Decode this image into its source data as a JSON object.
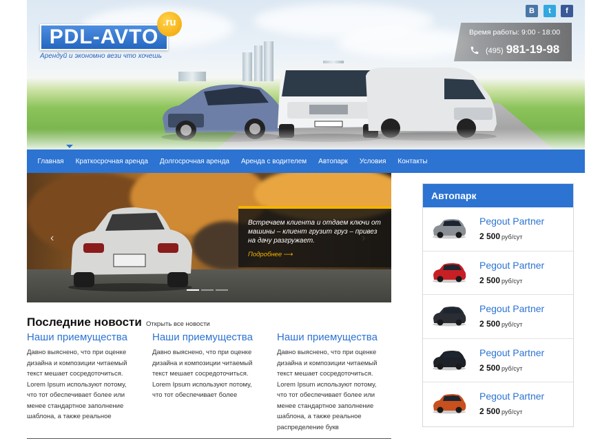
{
  "header": {
    "logo_text": "PDL-AVTO",
    "logo_suffix": ".ru",
    "slogan": "Арендуй и экономно вези что хочешь",
    "work_hours": "Время работы: 9:00 - 18:00",
    "phone_code": "(495)",
    "phone_number": "981-19-98",
    "social": [
      {
        "name": "vk",
        "label": "B",
        "color": "#4a76a8"
      },
      {
        "name": "twitter",
        "label": "t",
        "color": "#32a7e0"
      },
      {
        "name": "facebook",
        "label": "f",
        "color": "#3b5998"
      }
    ]
  },
  "nav": {
    "items": [
      "Главная",
      "Краткосрочная аренда",
      "Долгосрочная аренда",
      "Аренда с водителем",
      "Автопарк",
      "Условия",
      "Контакты"
    ]
  },
  "slider": {
    "text": "Встречаем клиента и отдаем ключи от машины – клиент грузит груз – привез на дачу разгружает.",
    "more": "Подробнее",
    "more_arrow": "⟶",
    "prev_arrow": "‹",
    "next_arrow": "›",
    "active_slide": 1,
    "slide_count": 3
  },
  "news": {
    "title": "Последние новости",
    "all_link": "Открыть все новости",
    "items": [
      {
        "title": "Наши приемущества",
        "text": "Давно выяснено, что при оценке дизайна и композиции читаемый текст мешает сосредоточиться. Lorem Ipsum используют потому, что тот обеспечивает более или менее стандартное заполнение шаблона, а также реальное"
      },
      {
        "title": "Наши приемущества",
        "text": "Давно выяснено, что при оценке дизайна и композиции читаемый текст мешает сосредоточиться. Lorem Ipsum используют потому, что тот обеспечивает более"
      },
      {
        "title": "Наши приемущества",
        "text": "Давно выяснено, что при оценке дизайна и композиции читаемый текст мешает сосредоточиться. Lorem Ipsum используют потому, что тот обеспечивает более или менее стандартное заполнение шаблона, а также реальное распределение букв"
      }
    ]
  },
  "fleet": {
    "title": "Автопарк",
    "items": [
      {
        "name": "Pegout Partner",
        "price": "2 500",
        "unit": "руб/сут",
        "car_color": "#8a8f96"
      },
      {
        "name": "Pegout Partner",
        "price": "2 500",
        "unit": "руб/сут",
        "car_color": "#c81f25"
      },
      {
        "name": "Pegout Partner",
        "price": "2 500",
        "unit": "руб/сут",
        "car_color": "#2a2d33"
      },
      {
        "name": "Pegout Partner",
        "price": "2 500",
        "unit": "руб/сут",
        "car_color": "#1e2127"
      },
      {
        "name": "Pegout Partner",
        "price": "2 500",
        "unit": "руб/сут",
        "car_color": "#c8501e"
      }
    ]
  }
}
